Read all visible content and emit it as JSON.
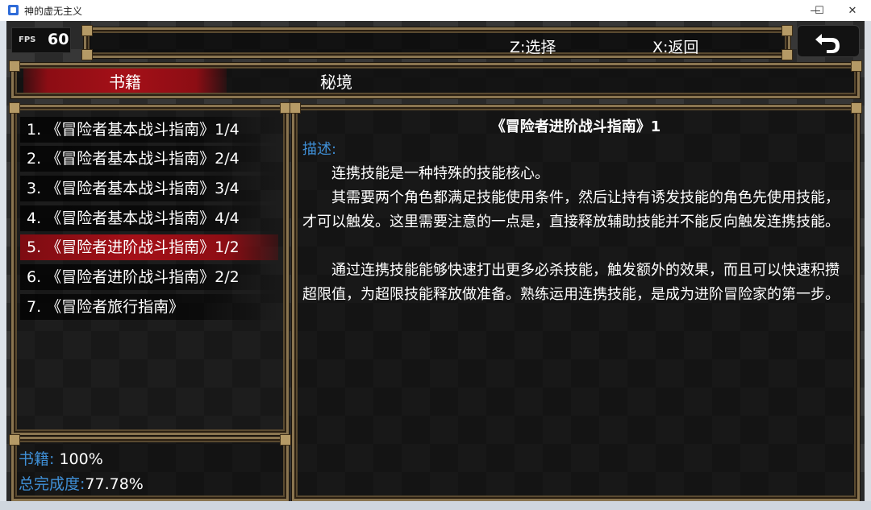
{
  "window": {
    "title": "神的虚无主义",
    "minimize_glyph": "—",
    "maximize_glyph": "☐",
    "close_glyph": "✕"
  },
  "hud": {
    "fps_label": "FPS",
    "fps_value": "60"
  },
  "hints": {
    "confirm": "Z:选择",
    "back": "X:返回"
  },
  "back_button": {
    "icon": "return-arrow-icon"
  },
  "tabs": [
    {
      "label": "书籍",
      "active": true
    },
    {
      "label": "秘境",
      "active": false
    }
  ],
  "books": [
    {
      "label": "1. 《冒险者基本战斗指南》1/4",
      "selected": false
    },
    {
      "label": "2. 《冒险者基本战斗指南》2/4",
      "selected": false
    },
    {
      "label": "3. 《冒险者基本战斗指南》3/4",
      "selected": false
    },
    {
      "label": "4. 《冒险者基本战斗指南》4/4",
      "selected": false
    },
    {
      "label": "5. 《冒险者进阶战斗指南》1/2",
      "selected": true
    },
    {
      "label": "6. 《冒险者进阶战斗指南》2/2",
      "selected": false
    },
    {
      "label": "7. 《冒险者旅行指南》",
      "selected": false
    }
  ],
  "stats": {
    "books_label": "书籍:",
    "books_value": " 100%",
    "completion_label": "总完成度:",
    "completion_value": "77.78%"
  },
  "detail": {
    "title": "《冒险者进阶战斗指南》1",
    "desc_label": "描述:",
    "paragraphs": [
      "连携技能是一种特殊的技能核心。",
      "其需要两个角色都满足技能使用条件，然后让持有诱发技能的角色先使用技能，才可以触发。这里需要注意的一点是，直接释放辅助技能并不能反向触发连携技能。",
      "通过连携技能能够快速打出更多必杀技能，触发额外的效果，而且可以快速积攒超限值，为超限技能释放做准备。熟练运用连携技能，是成为进阶冒险家的第一步。"
    ]
  },
  "colors": {
    "accent_red": "#a51018",
    "label_blue": "#3f8fd6",
    "frame_gold": "#8a7550"
  }
}
